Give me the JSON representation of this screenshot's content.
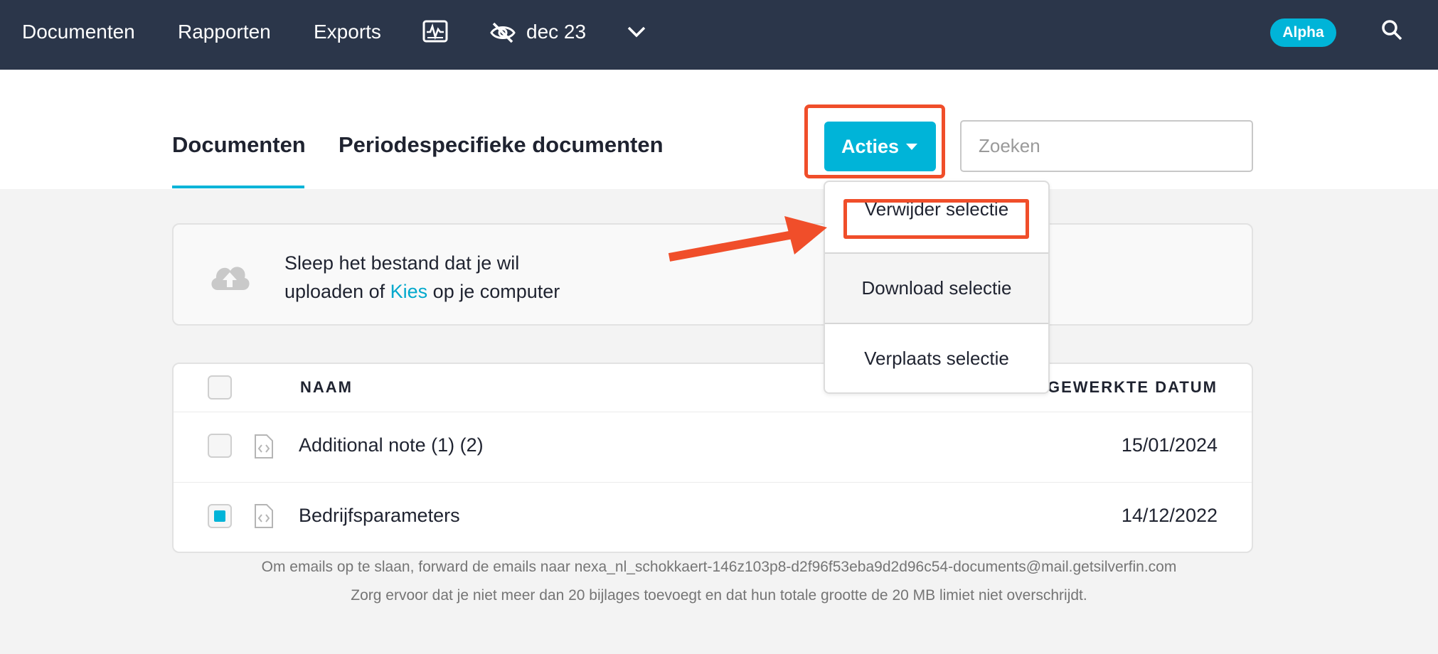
{
  "topnav": {
    "links": [
      "Documenten",
      "Rapporten",
      "Exports"
    ],
    "period_label": "dec 23",
    "badge": "Alpha",
    "icons": [
      "monitor-chart-icon",
      "eye-slash-icon",
      "chevron-down-icon",
      "search-icon"
    ]
  },
  "tabs": [
    "Documenten",
    "Periodespecifieke documenten"
  ],
  "actions": {
    "button_label": "Acties",
    "menu_items": [
      "Verwijder selectie",
      "Download selectie",
      "Verplaats selectie"
    ]
  },
  "search": {
    "placeholder": "Zoeken",
    "value": ""
  },
  "upload": {
    "line1": "Sleep het bestand dat je wil",
    "line2_prefix": "uploaden of ",
    "link": "Kies",
    "line2_suffix": " op je computer",
    "icon": "cloud-upload-icon"
  },
  "table": {
    "columns": [
      "NAAM",
      "BIJGEWERKTE DATUM"
    ],
    "rows": [
      {
        "name": "Additional note (1) (2)",
        "date": "15/01/2024",
        "checked": false,
        "icon": "code-file-icon"
      },
      {
        "name": "Bedrijfsparameters",
        "date": "14/12/2022",
        "checked": true,
        "icon": "code-file-icon"
      }
    ]
  },
  "footer": {
    "line1": "Om emails op te slaan, forward de emails naar nexa_nl_schokkaert-146z103p8-d2f96f53eba9d2d96c54-documents@mail.getsilverfin.com",
    "line2": "Zorg ervoor dat je niet meer dan 20 bijlages toevoegt en dat hun totale grootte de 20 MB limiet niet overschrijdt."
  },
  "colors": {
    "nav_bg": "#2b364a",
    "accent": "#00b4d8",
    "highlight": "#f04e2a"
  }
}
